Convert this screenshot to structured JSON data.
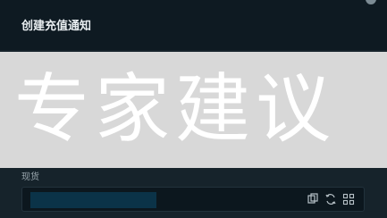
{
  "dialog": {
    "title": "创建充值通知"
  },
  "overlay": {
    "text": "专家建议"
  },
  "form": {
    "field_label": "现货",
    "field_value": "",
    "icons": [
      "copy-icon",
      "refresh-icon",
      "grid-icon"
    ]
  }
}
